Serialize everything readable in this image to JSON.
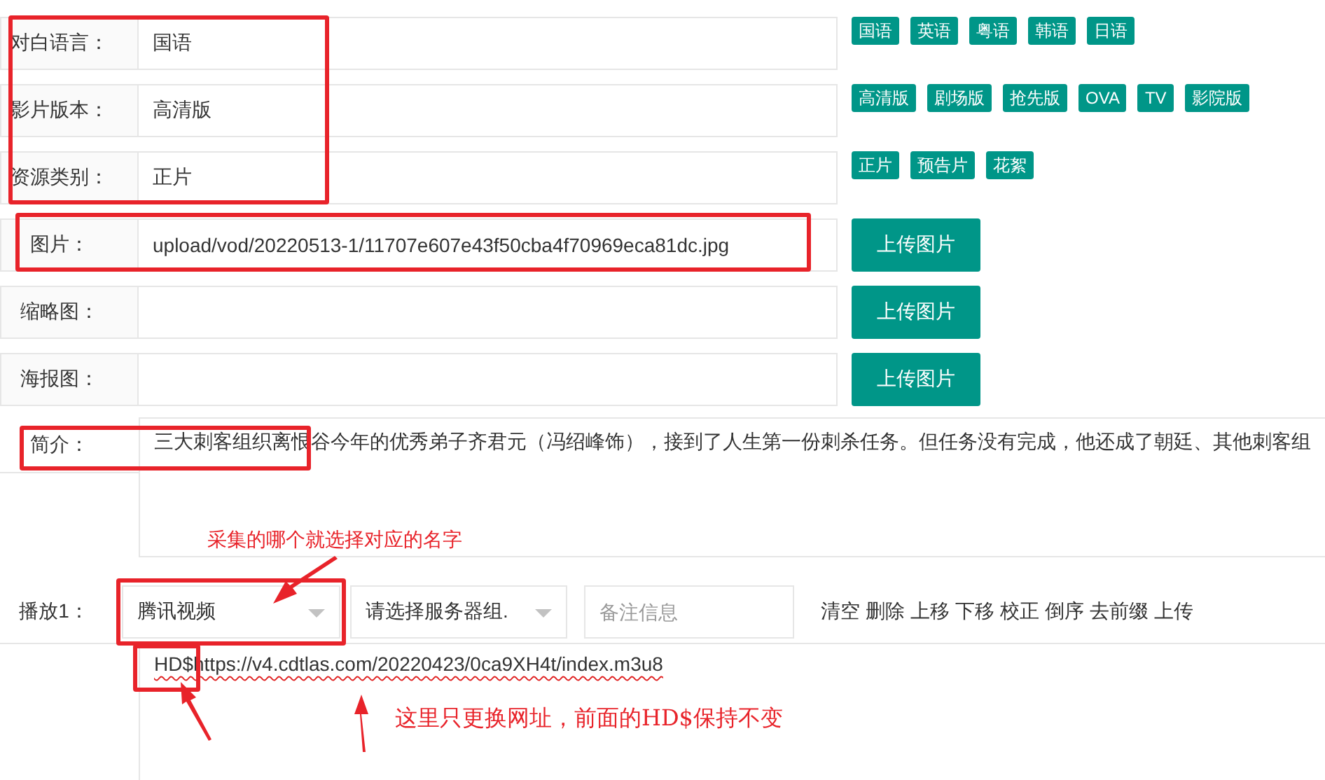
{
  "fields": [
    {
      "kind": "text",
      "label": "对白语言：",
      "value": "国语",
      "tags": [
        "国语",
        "英语",
        "粤语",
        "韩语",
        "日语"
      ]
    },
    {
      "kind": "text",
      "label": "影片版本：",
      "value": "高清版",
      "tags": [
        "高清版",
        "剧场版",
        "抢先版",
        "OVA",
        "TV",
        "影院版"
      ]
    },
    {
      "kind": "text",
      "label": "资源类别：",
      "value": "正片",
      "tags": [
        "正片",
        "预告片",
        "花絮"
      ]
    },
    {
      "kind": "upload",
      "label": "图片：",
      "value": "upload/vod/20220513-1/11707e607e43f50cba4f70969eca81dc.jpg",
      "button": "上传图片"
    },
    {
      "kind": "upload",
      "label": "缩略图：",
      "button": "上传图片"
    },
    {
      "kind": "upload",
      "label": "海报图：",
      "button": "上传图片"
    }
  ],
  "intro": {
    "label": "简介：",
    "value": "三大刺客组织离恨谷今年的优秀弟子齐君元（冯绍峰饰），接到了人生第一份刺杀任务。但任务没有完成，他还成了朝廷、其他刺客组"
  },
  "play": {
    "label": "播放1：",
    "player": "腾讯视频",
    "server": "请选择服务器组.",
    "note_placeholder": "备注信息",
    "actions": [
      "清空",
      "删除",
      "上移",
      "下移",
      "校正",
      "倒序",
      "去前缀",
      "上传"
    ],
    "urls": "HD$https://v4.cdtlas.com/20220423/0ca9XH4t/index.m3u8"
  },
  "annotations": [
    {
      "kind": "note",
      "text": "采集的哪个就选择对应的名字"
    },
    {
      "kind": "note",
      "text": "这里只更换网址，前面的HD$保持不变"
    }
  ]
}
